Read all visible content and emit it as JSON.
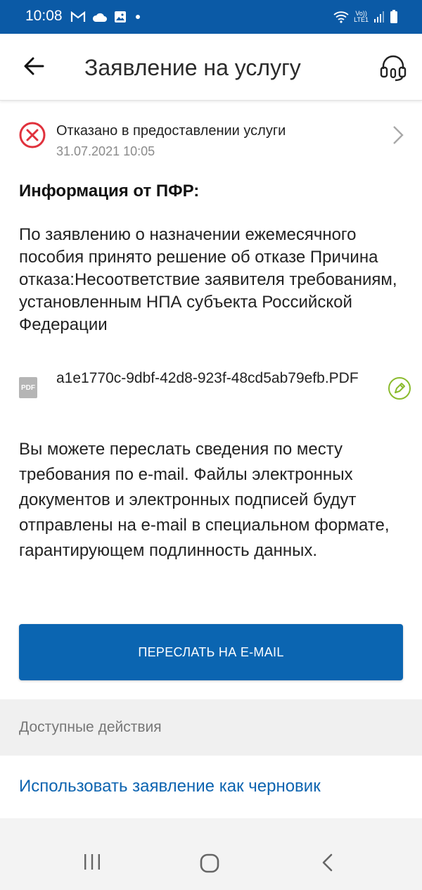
{
  "status_bar": {
    "time": "10:08",
    "lte_top": "Vo))",
    "lte_bottom": "LTE1"
  },
  "app_bar": {
    "title": "Заявление на услугу"
  },
  "application_status": {
    "text": "Отказано в предоставлении услуги",
    "date": "31.07.2021 10:05"
  },
  "info": {
    "heading": "Информация от ПФР:",
    "body": "По заявлению о назначении ежемесячного пособия принято решение об отказе Причина отказа:Несоответствие заявителя требованиям, установленным НПА субъекта Российской Федерации"
  },
  "attachment": {
    "type_label": "PDF",
    "file_name": "a1e1770c-9dbf-42d8-923f-48cd5ab79efb.PDF"
  },
  "email_info": "Вы можете переслать сведения по месту требования по e-mail. Файлы электронных документов и электронных подписей будут отправлены на e-mail в специальном формате, гарантирующем подлинность данных.",
  "email_button_label": "ПЕРЕСЛАТЬ НА E-MAIL",
  "actions": {
    "header": "Доступные действия",
    "draft_link": "Использовать заявление как черновик"
  },
  "colors": {
    "primary": "#0b65b1",
    "status_bar": "#0b5aa6",
    "error": "#e0313c",
    "sign_accent": "#8bbb2e"
  },
  "icons": [
    "gmail-icon",
    "cloud-icon",
    "gallery-icon",
    "wifi-icon",
    "signal-icon",
    "battery-icon",
    "back-arrow-icon",
    "headset-icon",
    "error-circle-icon",
    "chevron-right-icon",
    "pdf-icon",
    "signature-pen-icon"
  ]
}
